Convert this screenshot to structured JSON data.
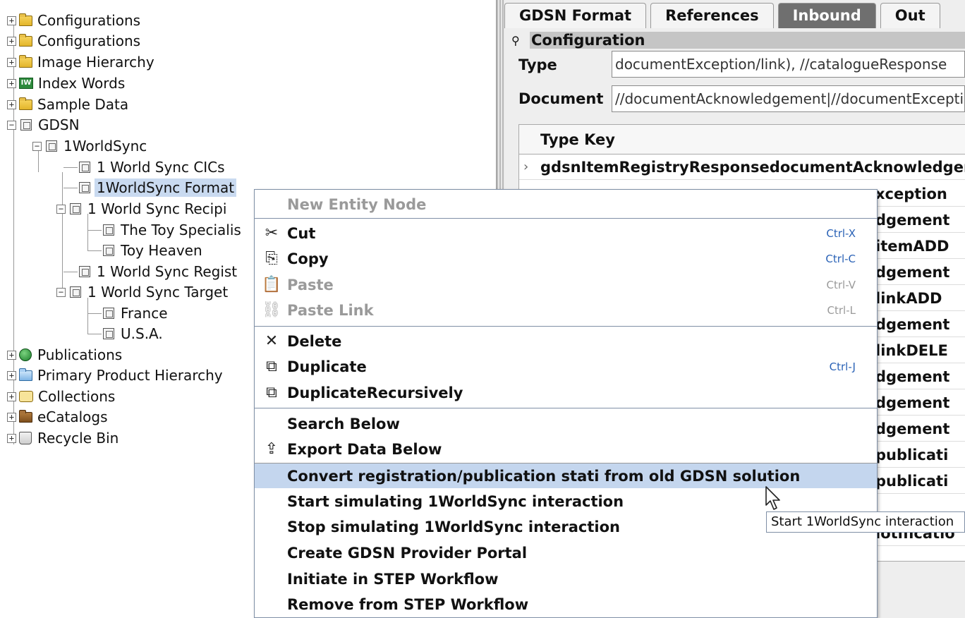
{
  "tree": {
    "nodes": [
      {
        "label": "Configurations",
        "icon": "folder-icon"
      },
      {
        "label": "Configurations",
        "icon": "folder-icon"
      },
      {
        "label": "Image Hierarchy",
        "icon": "folder-icon"
      },
      {
        "label": "Index Words",
        "icon": "index-words-icon"
      },
      {
        "label": "Sample Data",
        "icon": "folder-icon"
      },
      {
        "label": "GDSN",
        "icon": "entity-node-icon"
      },
      {
        "label": "1WorldSync",
        "icon": "entity-node-icon"
      },
      {
        "label": "1 World Sync CICs",
        "icon": "entity-node-icon"
      },
      {
        "label": "1WorldSync Format",
        "icon": "entity-node-icon",
        "selected": true
      },
      {
        "label": "1 World Sync Recipi",
        "icon": "entity-node-icon"
      },
      {
        "label": "The Toy Specialis",
        "icon": "entity-node-icon"
      },
      {
        "label": "Toy Heaven",
        "icon": "entity-node-icon"
      },
      {
        "label": "1 World Sync Regist",
        "icon": "entity-node-icon"
      },
      {
        "label": "1 World Sync Target",
        "icon": "entity-node-icon"
      },
      {
        "label": "France",
        "icon": "entity-node-icon"
      },
      {
        "label": "U.S.A.",
        "icon": "entity-node-icon"
      },
      {
        "label": "Publications",
        "icon": "publications-icon"
      },
      {
        "label": "Primary Product Hierarchy",
        "icon": "folder-blue-icon"
      },
      {
        "label": "Collections",
        "icon": "collections-icon"
      },
      {
        "label": "eCatalogs",
        "icon": "folder-brown-icon"
      },
      {
        "label": "Recycle Bin",
        "icon": "recycle-bin-icon"
      }
    ]
  },
  "right_panel": {
    "tabs": [
      {
        "label": "GDSN Format"
      },
      {
        "label": "References"
      },
      {
        "label": "Inbound",
        "active": true
      },
      {
        "label": "Out"
      }
    ],
    "section_title": "Configuration",
    "type_label": "Type",
    "type_value": "documentException/link), //catalogueResponse",
    "document_label": "Document",
    "document_value": "//documentAcknowledgement|//documentException",
    "table": {
      "header": "Type Key",
      "rows": [
        {
          "full": "gdsnItemRegistryResponsedocumentAcknowledgement"
        },
        {
          "tail": "xception"
        },
        {
          "tail": "dgement"
        },
        {
          "tail": "itemADD"
        },
        {
          "tail": "dgement"
        },
        {
          "tail": "linkADD"
        },
        {
          "tail": "dgement"
        },
        {
          "tail": "linkDELE"
        },
        {
          "tail": "dgement"
        },
        {
          "tail": "dgement"
        },
        {
          "tail": "dgement"
        },
        {
          "tail": "publicati"
        },
        {
          "tail": "publicati"
        },
        {
          "tail": ""
        },
        {
          "tail": "lotificatio"
        }
      ]
    }
  },
  "context_menu": {
    "items": [
      {
        "label": "New Entity Node",
        "disabled": true
      },
      {
        "label": "Cut",
        "shortcut": "Ctrl-X",
        "icon": "scissors-icon"
      },
      {
        "label": "Copy",
        "shortcut": "Ctrl-C",
        "icon": "copy-icon"
      },
      {
        "label": "Paste",
        "shortcut": "Ctrl-V",
        "icon": "paste-icon",
        "disabled": true
      },
      {
        "label": "Paste Link",
        "shortcut": "Ctrl-L",
        "icon": "paste-link-icon",
        "disabled": true
      },
      {
        "label": "Delete",
        "icon": "delete-icon"
      },
      {
        "label": "Duplicate",
        "shortcut": "Ctrl-J",
        "icon": "duplicate-icon"
      },
      {
        "label": "DuplicateRecursively",
        "icon": "duplicate-icon"
      },
      {
        "label": "Search Below"
      },
      {
        "label": "Export Data Below",
        "icon": "export-icon"
      },
      {
        "label": "Convert registration/publication stati from old GDSN solution",
        "highlighted": true
      },
      {
        "label": "Start simulating 1WorldSync interaction"
      },
      {
        "label": "Stop simulating 1WorldSync interaction"
      },
      {
        "label": "Create GDSN Provider Portal"
      },
      {
        "label": "Initiate in STEP Workflow"
      },
      {
        "label": "Remove from STEP Workflow"
      }
    ]
  },
  "tooltip": {
    "text": "Start 1WorldSync interaction"
  },
  "colors": {
    "selection": "#c9daf0",
    "menu_highlight": "#c4d6ee",
    "shortcut": "#2a62b6",
    "active_tab": "#6f6f6f"
  }
}
